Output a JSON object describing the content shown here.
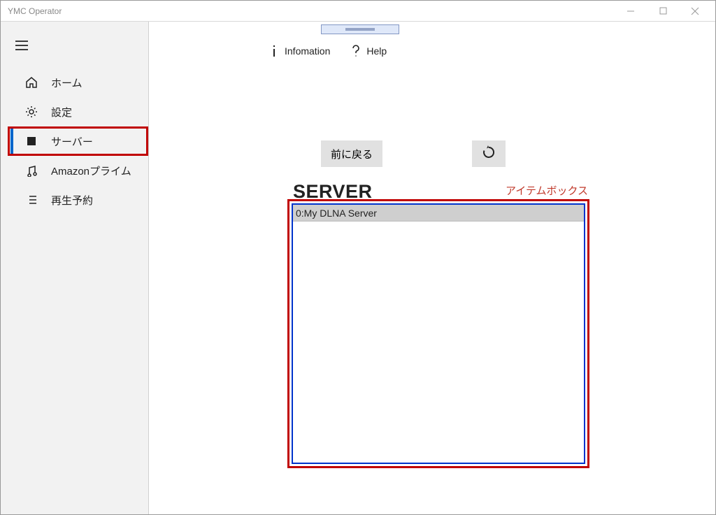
{
  "window": {
    "title": "YMC Operator"
  },
  "sidebar": {
    "items": [
      {
        "key": "home",
        "label": "ホーム",
        "icon": "home-icon",
        "active": false
      },
      {
        "key": "settings",
        "label": "設定",
        "icon": "gear-icon",
        "active": false
      },
      {
        "key": "server",
        "label": "サーバー",
        "icon": "server-icon",
        "active": true
      },
      {
        "key": "amazon",
        "label": "Amazonプライム",
        "icon": "music-icon",
        "active": false
      },
      {
        "key": "schedule",
        "label": "再生予約",
        "icon": "list-icon",
        "active": false
      }
    ]
  },
  "toolbar": {
    "info_label": "Infomation",
    "help_label": "Help"
  },
  "controls": {
    "back_label": "前に戻る",
    "reload_label": "リロード"
  },
  "section": {
    "title": "SERVER"
  },
  "annotation": {
    "itembox_label": "アイテムボックス"
  },
  "server_list": [
    {
      "label": "0:My DLNA Server"
    }
  ],
  "colors": {
    "highlight_red": "#c00000",
    "box_blue": "#0033cc",
    "active_indicator": "#0066cc"
  }
}
